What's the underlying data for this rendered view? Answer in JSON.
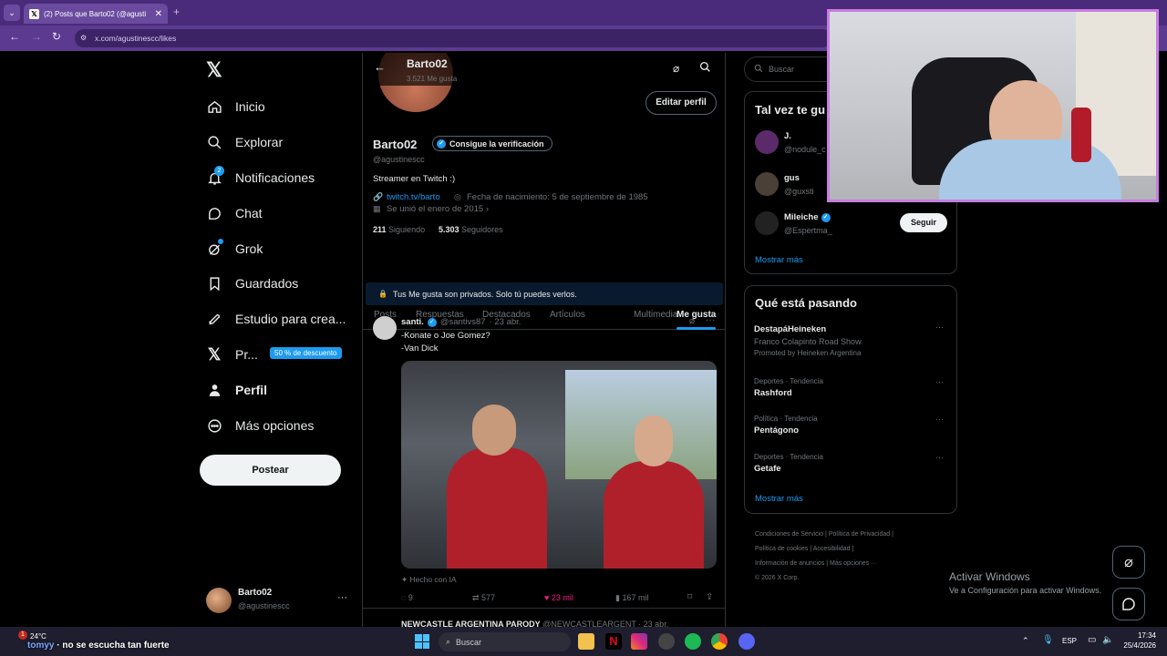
{
  "browser": {
    "tab_title": "(2) Posts que Barto02 (@agusti",
    "url": "x.com/agustinescc/likes"
  },
  "sidebar": {
    "items": [
      {
        "label": "Inicio"
      },
      {
        "label": "Explorar"
      },
      {
        "label": "Notificaciones",
        "badge": "2"
      },
      {
        "label": "Chat"
      },
      {
        "label": "Grok"
      },
      {
        "label": "Guardados"
      },
      {
        "label": "Estudio para crea..."
      },
      {
        "label": "Pr...",
        "promo": "50 % de descuento"
      },
      {
        "label": "Perfil"
      },
      {
        "label": "Más opciones"
      }
    ],
    "post_button": "Postear",
    "account": {
      "name": "Barto02",
      "handle": "@agustinescc",
      "more": "···"
    }
  },
  "profile": {
    "header_name": "Barto02",
    "header_sub": "3.521 Me gusta",
    "edit_button": "Editar perfil",
    "name": "Barto02",
    "verify_button": "Consigue la verificación",
    "handle": "@agustinescc",
    "bio": "Streamer en Twitch :)",
    "link": "twitch.tv/barto",
    "birth": "Fecha de nacimiento: 5 de septiembre de 1985",
    "joined": "Se unió el enero de 2015",
    "following_count": "211",
    "following_label": "Siguiendo",
    "followers_count": "5.303",
    "followers_label": "Seguidores",
    "tabs": [
      "Posts",
      "Respuestas",
      "Destacados",
      "Artículos",
      "Multimedia",
      "Me gusta"
    ],
    "private_notice": "Tus Me gusta son privados. Solo tú puedes verlos."
  },
  "tweet": {
    "author": "santi.",
    "handle": "@santivs87",
    "date": "· 23 abr.",
    "line1": "-Konate o Joe Gomez?",
    "line2": "-Van Dick",
    "ai_label": "Hecho con IA",
    "replies": "9",
    "retweets": "577",
    "likes": "23 mil",
    "views": "167 mil",
    "next_author": "NEWCASTLE ARGENTINA PARODY",
    "next_meta": "@NEWCASTLEARGENT · 23 abr."
  },
  "right": {
    "search_placeholder": "Buscar",
    "who_title": "Tal vez te gu",
    "who": [
      {
        "name": "J.",
        "handle": "@nodule_c"
      },
      {
        "name": "gus",
        "handle": "@guxsti"
      },
      {
        "name": "Mileiche",
        "handle": "@Espertma_",
        "button": "Seguir"
      }
    ],
    "show_more": "Mostrar más",
    "trends_title": "Qué está pasando",
    "trends": [
      {
        "title": "DestapáHeineken",
        "sub": "Franco Colapinto Road Show",
        "promo": "Promoted by Heineken Argentina"
      },
      {
        "meta": "Deportes · Tendencia",
        "title": "Rashford"
      },
      {
        "meta": "Política · Tendencia",
        "title": "Pentágono"
      },
      {
        "meta": "Deportes · Tendencia",
        "title": "Getafe"
      }
    ],
    "trends_more": "Mostrar más",
    "footer": [
      "Condiciones de Servicio",
      "Política de Privacidad",
      "Política de cookies",
      "Accesibilidad",
      "Información de anuncios",
      "Más opciones ···",
      "© 2026 X Corp."
    ]
  },
  "overlay": {
    "activate_title": "Activar Windows",
    "activate_sub": "Ve a Configuración para activar Windows.",
    "chat_text": "no se escucha tan fuerte",
    "chat_user": "tomyy"
  },
  "taskbar": {
    "weather_temp": "24°C",
    "weather_badge": "1",
    "search": "Buscar",
    "lang": "ESP",
    "time": "17:34",
    "date": "25/4/2026"
  },
  "colors": {
    "accent": "#1d9bf0",
    "like": "#f91880",
    "window_frame": "#5b3a8f"
  }
}
